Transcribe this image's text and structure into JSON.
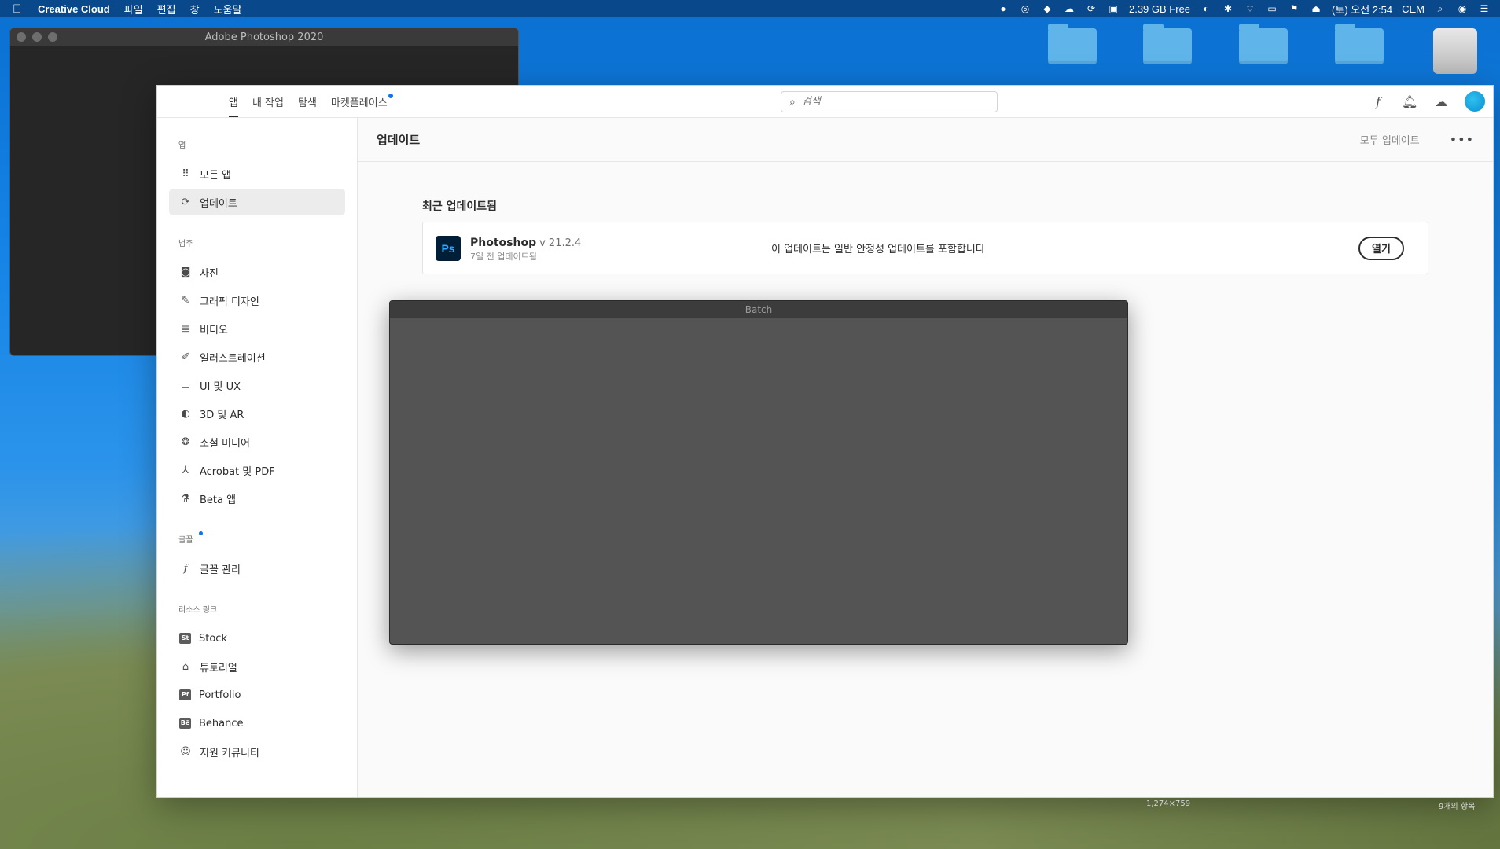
{
  "menubar": {
    "app_name": "Creative Cloud",
    "menus": [
      "파일",
      "편집",
      "창",
      "도움말"
    ],
    "storage": "2.39 GB Free",
    "datetime": "(토) 오전 2:54",
    "user": "CEM"
  },
  "desktop": {
    "icons": [
      {
        "label": "",
        "type": "folder"
      },
      {
        "label": "",
        "type": "folder"
      },
      {
        "label": "",
        "type": "folder-dropbox"
      },
      {
        "label": "",
        "type": "folder"
      },
      {
        "label": "",
        "type": "drive"
      }
    ],
    "bottom_left_text": "1,274×759",
    "bottom_right_text": "9개의 항목"
  },
  "ps_window": {
    "title": "Adobe Photoshop 2020"
  },
  "cc": {
    "tabs": [
      {
        "label": "앱",
        "active": true
      },
      {
        "label": "내 작업",
        "active": false
      },
      {
        "label": "탐색",
        "active": false
      },
      {
        "label": "마켓플레이스",
        "active": false,
        "dot": true
      }
    ],
    "search": {
      "placeholder": "검색"
    },
    "sidebar": {
      "apps_label": "앱",
      "apps": [
        {
          "label": "모든 앱",
          "icon": "grid-icon",
          "active": false
        },
        {
          "label": "업데이트",
          "icon": "refresh-icon",
          "active": true
        }
      ],
      "categories_label": "범주",
      "categories": [
        {
          "label": "사진",
          "icon": "camera-icon"
        },
        {
          "label": "그래픽 디자인",
          "icon": "pen-tool-icon"
        },
        {
          "label": "비디오",
          "icon": "film-icon"
        },
        {
          "label": "일러스트레이션",
          "icon": "brush-icon"
        },
        {
          "label": "UI 및 UX",
          "icon": "devices-icon"
        },
        {
          "label": "3D 및 AR",
          "icon": "3d-icon"
        },
        {
          "label": "소셜 미디어",
          "icon": "social-icon"
        },
        {
          "label": "Acrobat 및 PDF",
          "icon": "acrobat-icon"
        },
        {
          "label": "Beta 앱",
          "icon": "flask-icon"
        }
      ],
      "fonts_label": "글꼴",
      "fonts": [
        {
          "label": "글꼴 관리",
          "icon": "font-icon"
        }
      ],
      "resources_label": "리소스 링크",
      "resources": [
        {
          "label": "Stock",
          "icon": "stock-icon",
          "badge": "St"
        },
        {
          "label": "튜토리얼",
          "icon": "graduation-cap-icon"
        },
        {
          "label": "Portfolio",
          "icon": "portfolio-icon",
          "badge": "Pf"
        },
        {
          "label": "Behance",
          "icon": "behance-icon",
          "badge": "Bē"
        },
        {
          "label": "지원 커뮤니티",
          "icon": "community-icon"
        }
      ]
    },
    "main": {
      "title": "업데이트",
      "update_all": "모두 업데이트",
      "recent_title": "최근 업데이트됨",
      "card": {
        "logo": "Ps",
        "name": "Photoshop",
        "version": "v 21.2.4",
        "updated": "7일 전 업데이트됨",
        "description": "이 업데이트는 일반 안정성 업데이트를 포함합니다",
        "open_label": "열기"
      }
    }
  },
  "batch": {
    "title": "Batch"
  },
  "colors": {
    "accent_dot": "#1473e6",
    "ps_logo_bg": "#001e36",
    "ps_logo_fg": "#31a8ff"
  }
}
